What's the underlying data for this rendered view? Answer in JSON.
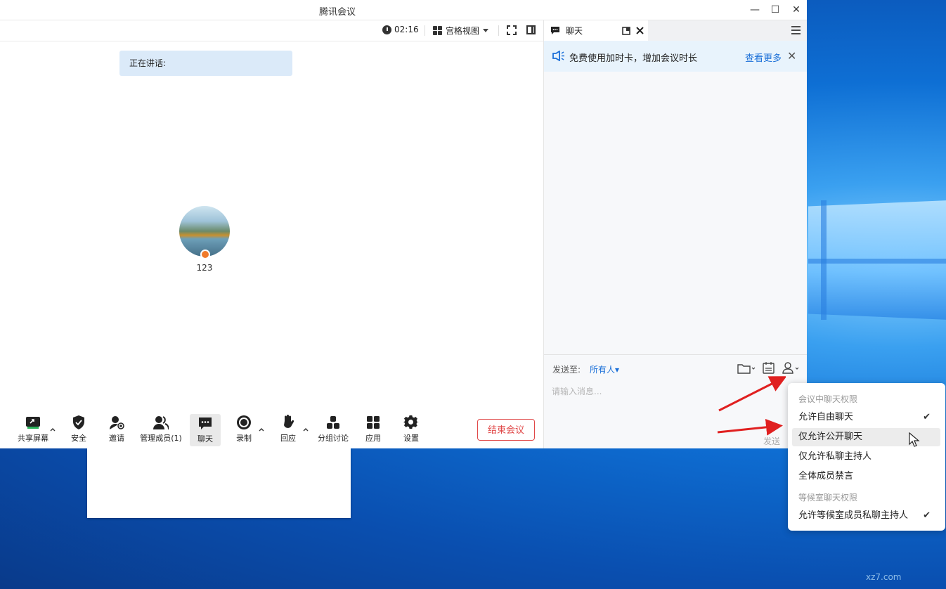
{
  "window": {
    "title": "腾讯会议"
  },
  "meeting": {
    "timer": "02:16",
    "view_mode": "宫格视图",
    "speaking_label": "正在讲话:",
    "participant_name": "123",
    "end_button": "结束会议"
  },
  "toolbar": {
    "items": [
      {
        "label": "共享屏幕",
        "icon": "share-screen-icon"
      },
      {
        "label": "安全",
        "icon": "shield-icon"
      },
      {
        "label": "邀请",
        "icon": "invite-icon"
      },
      {
        "label": "管理成员(1)",
        "icon": "members-icon"
      },
      {
        "label": "聊天",
        "icon": "chat-icon"
      },
      {
        "label": "录制",
        "icon": "record-icon"
      },
      {
        "label": "回应",
        "icon": "reaction-icon"
      },
      {
        "label": "分组讨论",
        "icon": "breakout-icon"
      },
      {
        "label": "应用",
        "icon": "apps-icon"
      },
      {
        "label": "设置",
        "icon": "gear-icon"
      }
    ]
  },
  "chat": {
    "tab_label": "聊天",
    "promo_text": "免费使用加时卡，增加会议时长",
    "promo_link": "查看更多",
    "send_to_label": "发送至:",
    "send_to_value": "所有人",
    "input_placeholder": "请输入消息...",
    "send_button": "发送"
  },
  "permission_menu": {
    "meeting_header": "会议中聊天权限",
    "items": [
      {
        "label": "允许自由聊天",
        "checked": true
      },
      {
        "label": "仅允许公开聊天",
        "checked": false
      },
      {
        "label": "仅允许私聊主持人",
        "checked": false
      },
      {
        "label": "全体成员禁言",
        "checked": false
      }
    ],
    "waiting_header": "等候室聊天权限",
    "waiting_item": {
      "label": "允许等候室成员私聊主持人",
      "checked": true
    }
  },
  "colors": {
    "accent": "#1a6fd8",
    "danger": "#e04848",
    "promo_bg": "#e8f3fc"
  },
  "watermark": {
    "text": "xz7.com"
  }
}
